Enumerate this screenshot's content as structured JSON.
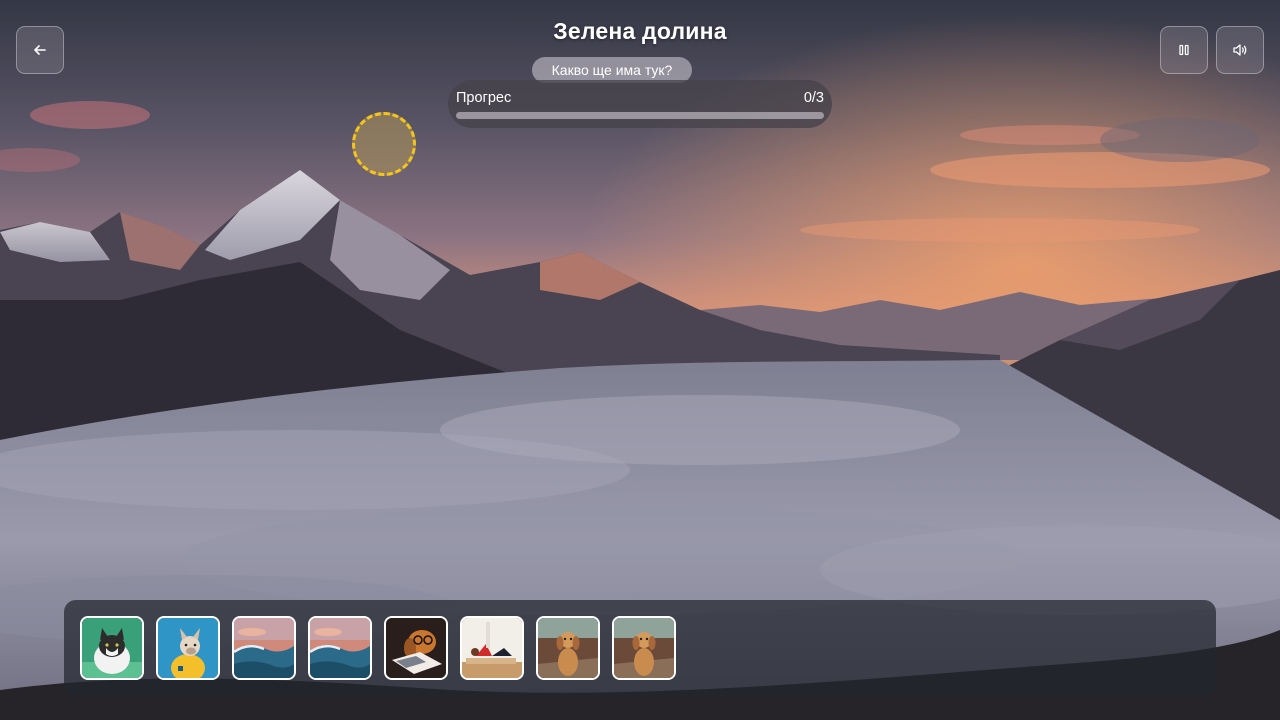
{
  "header": {
    "title": "Зелена долина",
    "hint": "Какво ще има тук?"
  },
  "progress": {
    "label": "Прогрес",
    "counter": "0/3",
    "value": 0
  },
  "controls": {
    "back_icon": "arrow-left-icon",
    "pause_icon": "pause-icon",
    "sound_icon": "volume-icon"
  },
  "hotspot": {
    "icon": "dashed-target-circle",
    "color": "#f5c518"
  },
  "tray": {
    "items": [
      {
        "name": "cat",
        "background": "#3aa07a"
      },
      {
        "name": "dog-yellow-hoodie",
        "background": "#2f95c6"
      },
      {
        "name": "ocean-wave",
        "background": "#cf8a7a"
      },
      {
        "name": "ocean-wave",
        "background": "#cf8a7a"
      },
      {
        "name": "dog-with-glasses-reading",
        "background": "#2a1e1c"
      },
      {
        "name": "person-exercising",
        "background": "#f2eee8"
      },
      {
        "name": "puppy-sitting",
        "background": "#6b4a3a"
      },
      {
        "name": "puppy-sitting",
        "background": "#6b4a3a"
      }
    ]
  },
  "colors": {
    "accent": "#f2c81c",
    "sky_top": "#3a3d4b",
    "sky_horizon": "#e29a74"
  }
}
